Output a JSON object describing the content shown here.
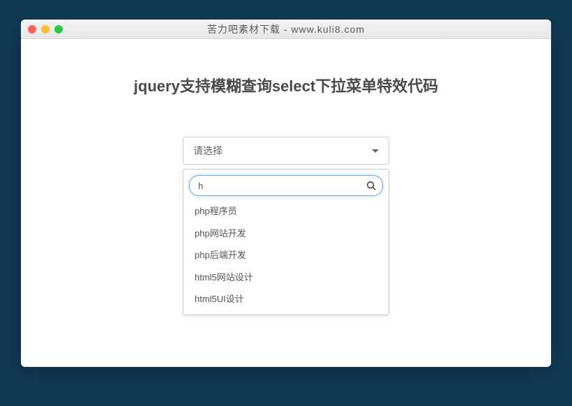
{
  "window": {
    "title": "苦力吧素材下载 - www.kuli8.com"
  },
  "page": {
    "heading": "jquery支持模糊查询select下拉菜单特效代码"
  },
  "select": {
    "placeholder": "请选择",
    "search_value": "h",
    "options": [
      "php程序员",
      "php网站开发",
      "php后端开发",
      "html5网站设计",
      "html5UI设计"
    ]
  }
}
